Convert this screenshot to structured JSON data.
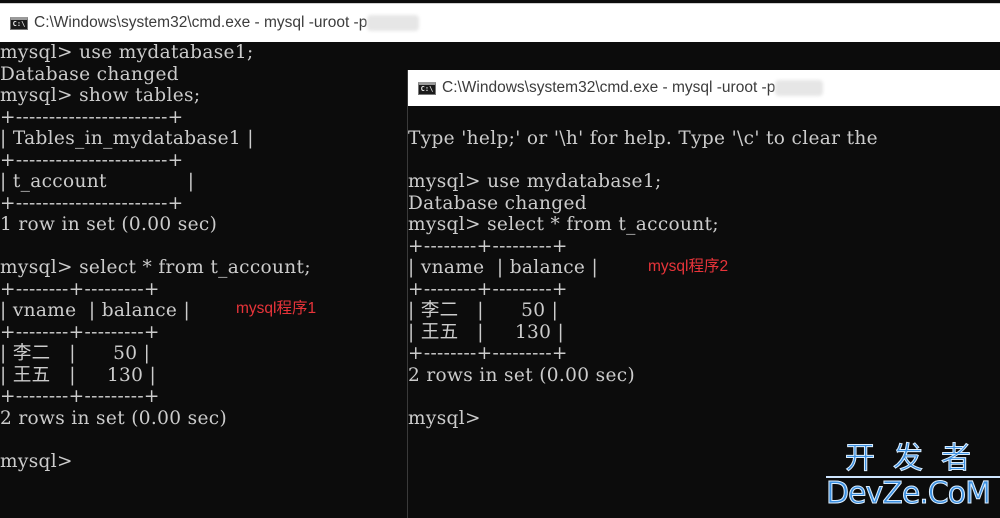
{
  "window1": {
    "title": "C:\\Windows\\system32\\cmd.exe - mysql  -uroot -p",
    "icon": "cmd-icon",
    "lines": [
      "mysql> use mydatabase1;",
      "Database changed",
      "mysql> show tables;",
      "+-----------------------+",
      "| Tables_in_mydatabase1 |",
      "+-----------------------+",
      "| t_account             |",
      "+-----------------------+",
      "1 row in set (0.00 sec)",
      "",
      "mysql> select * from t_account;",
      "+--------+---------+",
      "| vname  | balance |",
      "+--------+---------+",
      "| 李二   |      50 |",
      "| 王五   |     130 |",
      "+--------+---------+",
      "2 rows in set (0.00 sec)",
      "",
      "mysql>"
    ],
    "annotation": "mysql程序1"
  },
  "window2": {
    "title": "C:\\Windows\\system32\\cmd.exe - mysql  -uroot -p",
    "icon": "cmd-icon",
    "lines": [
      "Type 'help;' or '\\h' for help. Type '\\c' to clear the",
      "",
      "mysql> use mydatabase1;",
      "Database changed",
      "mysql> select * from t_account;",
      "+--------+---------+",
      "| vname  | balance |",
      "+--------+---------+",
      "| 李二   |      50 |",
      "| 王五   |     130 |",
      "+--------+---------+",
      "2 rows in set (0.00 sec)",
      "",
      "mysql>"
    ],
    "annotation": "mysql程序2"
  },
  "watermark": {
    "line1": "开发者",
    "line2": "DevZe.CoM",
    "color": "#3b8fe0"
  },
  "colors": {
    "console_bg": "#0c0c0c",
    "console_fg": "#cccccc",
    "annotation": "#e8343a"
  }
}
